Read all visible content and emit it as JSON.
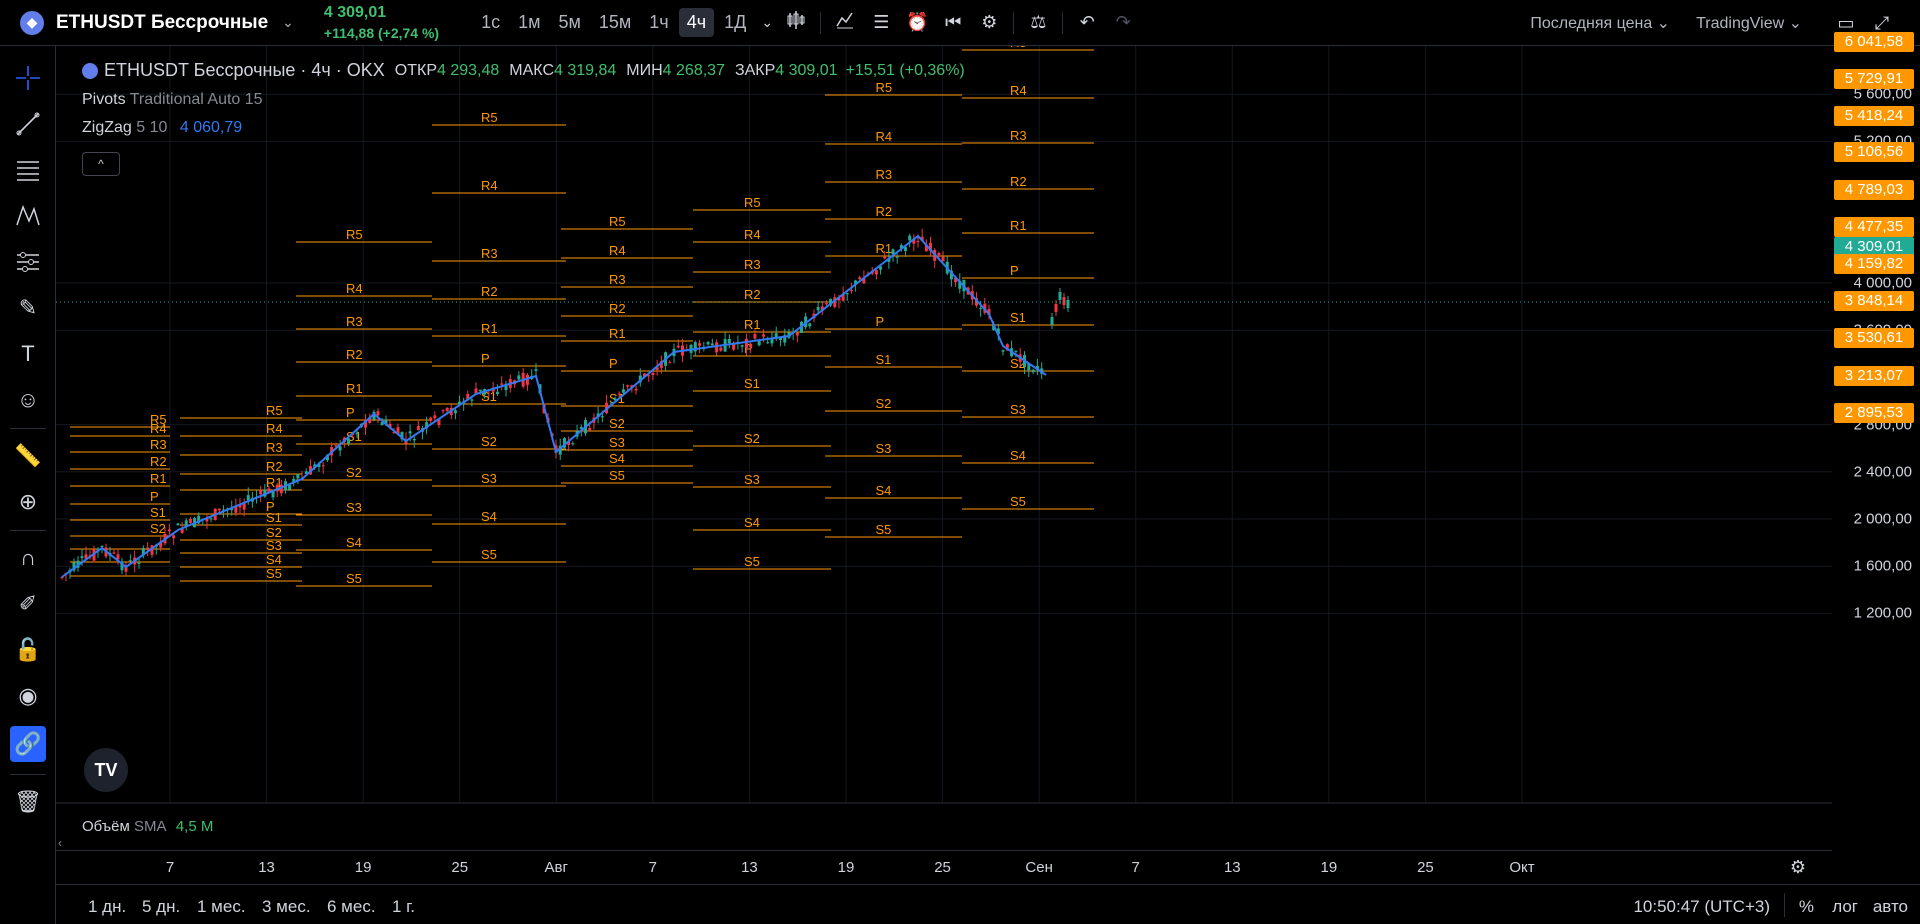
{
  "header": {
    "symbol": "ETHUSDT Бессрочные",
    "price": "4 309,01",
    "change": "+114,88 (+2,74 %)",
    "timeframes": [
      "1с",
      "1м",
      "5м",
      "15м",
      "1ч",
      "4ч",
      "1Д"
    ],
    "active_timeframe": "4ч",
    "price_type": "Последняя цена",
    "chart_type": "TradingView"
  },
  "legend": {
    "title": "ETHUSDT Бессрочные · 4ч · OKX",
    "open_label": "ОТКР",
    "open": "4 293,48",
    "high_label": "МАКС",
    "high": "4 319,84",
    "low_label": "МИН",
    "low": "4 268,37",
    "close_label": "ЗАКР",
    "close": "4 309,01",
    "close_change": "+15,51 (+0,36%)",
    "pivots_name": "Pivots",
    "pivots_params": "Traditional Auto 15",
    "zigzag_name": "ZigZag",
    "zigzag_params": "5 10",
    "zigzag_value": "4 060,79"
  },
  "volume": {
    "name": "Объём",
    "ma": "SMA",
    "value": "4,5 M"
  },
  "axis": {
    "price_ticks": [
      "5 600,00",
      "5 200,00",
      "4 000,00",
      "3 600,00",
      "2 800,00",
      "2 400,00",
      "2 000,00",
      "1 600,00",
      "1 200,00"
    ],
    "price_labels": [
      {
        "text": "6 041,58",
        "color": "#ff9800"
      },
      {
        "text": "5 729,91",
        "color": "#ff9800"
      },
      {
        "text": "5 418,24",
        "color": "#ff9800"
      },
      {
        "text": "5 106,56",
        "color": "#ff9800"
      },
      {
        "text": "4 789,03",
        "color": "#ff9800"
      },
      {
        "text": "4 477,35",
        "color": "#ff9800"
      },
      {
        "text": "4 309,01",
        "color": "#22ab94"
      },
      {
        "text": "4 159,82",
        "color": "#ff9800"
      },
      {
        "text": "3 848,14",
        "color": "#ff9800"
      },
      {
        "text": "3 530,61",
        "color": "#ff9800"
      },
      {
        "text": "3 213,07",
        "color": "#ff9800"
      },
      {
        "text": "2 895,53",
        "color": "#ff9800"
      }
    ],
    "time_ticks": [
      "7",
      "13",
      "19",
      "25",
      "Авг",
      "7",
      "13",
      "19",
      "25",
      "Сен",
      "7",
      "13",
      "19",
      "25",
      "Окт"
    ]
  },
  "bottom": {
    "ranges": [
      "1 дн.",
      "5 дн.",
      "1 мес.",
      "3 мес.",
      "6 мес.",
      "1 г."
    ],
    "clock": "10:50:47 (UTC+3)",
    "percent": "%",
    "log": "лог",
    "auto": "авто"
  },
  "pivot_labels": [
    "R5",
    "R4",
    "R3",
    "R2",
    "R1",
    "P",
    "S1",
    "S2",
    "S3",
    "S4",
    "S5"
  ],
  "colors": {
    "up": "#22ab94",
    "down": "#f23645",
    "pivot": "#ff9800",
    "zigzag": "#3179f5",
    "price": "#22ab94"
  }
}
